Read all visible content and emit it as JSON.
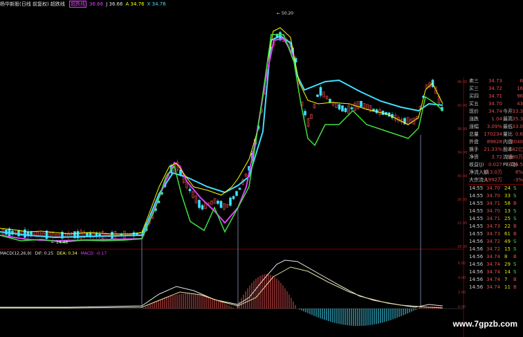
{
  "header": {
    "title": "杨华新股(日线 前复权) 超跌线",
    "ma_items": [
      {
        "label": "超跌线",
        "color": "#e040fb",
        "boxed": true
      },
      {
        "label": "36.66",
        "color": "#e040fb"
      },
      {
        "label": "J 36.66",
        "color": "#e0e0e0"
      },
      {
        "label": "A 34.76",
        "color": "#ffff00"
      },
      {
        "label": "X 34.76",
        "color": "#40e0ff"
      }
    ],
    "peak_label": "50.20",
    "low_label": "14.48"
  },
  "macd": {
    "title": "MACD(12,26,9)",
    "dif": "DIF: 0.25",
    "dea": "DEA: 0.34",
    "macd": "MACD: -0.17"
  },
  "quote": [
    {
      "k": "卖三",
      "v": "34.73",
      "k2": "",
      "v2": "6"
    },
    {
      "k": "买三",
      "v": "34.72",
      "k2": "",
      "v2": "16"
    },
    {
      "k": "买四",
      "v": "34.71",
      "k2": "",
      "v2": "96"
    },
    {
      "k": "买五",
      "v": "34.70",
      "k2": "",
      "v2": "43"
    },
    {
      "k": "现价",
      "v": "34.74",
      "k2": "今开",
      "v2": "33.3"
    },
    {
      "k": "涨跌",
      "v": "1.04",
      "k2": "最高",
      "v2": "35.3"
    },
    {
      "k": "涨幅",
      "v": "3.09%",
      "k2": "最低",
      "v2": "33.0"
    },
    {
      "k": "总量",
      "v": "170234",
      "k2": "量比",
      "v2": "0.6"
    },
    {
      "k": "外盘",
      "v": "89828",
      "k2": "内盘",
      "v2": "8040"
    },
    {
      "k": "换手",
      "v": "21.33%",
      "k2": "股本",
      "v2": "4.42亿"
    },
    {
      "k": "净资",
      "v": "3.72",
      "k2": "流通",
      "v2": "7980万"
    },
    {
      "k": "收益(J)",
      "v": "0.027",
      "k2": "PE(动)",
      "v2": "956.5"
    },
    {
      "k": "净流入额",
      "v": "113.0万",
      "k2": "",
      "v2": "8%"
    },
    {
      "k": "大宗流入",
      "v": "-1992万",
      "k2": "",
      "v2": "-3%"
    }
  ],
  "trades": [
    {
      "t": "14:55",
      "p": "34.70",
      "q": "24",
      "bs": "S"
    },
    {
      "t": "14:55",
      "p": "34.70",
      "q": "33",
      "bs": "S"
    },
    {
      "t": "14:55",
      "p": "34.71",
      "q": "58",
      "bs": "B"
    },
    {
      "t": "14:55",
      "p": "34.70",
      "q": "13",
      "bs": "S"
    },
    {
      "t": "14:55",
      "p": "34.71",
      "q": "25",
      "bs": "S"
    },
    {
      "t": "14:55",
      "p": "34.73",
      "q": "22",
      "bs": "B"
    },
    {
      "t": "14:55",
      "p": "34.73",
      "q": "61",
      "bs": "B"
    },
    {
      "t": "14:56",
      "p": "34.72",
      "q": "49",
      "bs": "S"
    },
    {
      "t": "14:56",
      "p": "34.72",
      "q": "15",
      "bs": "S"
    },
    {
      "t": "14:56",
      "p": "34.74",
      "q": "8",
      "bs": "B"
    },
    {
      "t": "14:56",
      "p": "34.74",
      "q": "29",
      "bs": "S"
    },
    {
      "t": "14:56",
      "p": "34.74",
      "q": "14",
      "bs": "S"
    },
    {
      "t": "14:56",
      "p": "34.74",
      "q": "7",
      "bs": "B"
    },
    {
      "t": "14:56",
      "p": "34.74",
      "q": "11",
      "bs": "B"
    }
  ],
  "y_axis": [
    "46.00",
    "42.00",
    "38.00",
    "34.00",
    "30.00",
    "26.00",
    "22.00",
    "18.00"
  ],
  "macd_axis": [
    "6.00",
    "4.00",
    "2.00",
    "0.00"
  ],
  "watermark": "www.7gpzb.com",
  "colors": {
    "up": "#e24b4b",
    "down": "#40e0ff",
    "bg": "#000000"
  }
}
